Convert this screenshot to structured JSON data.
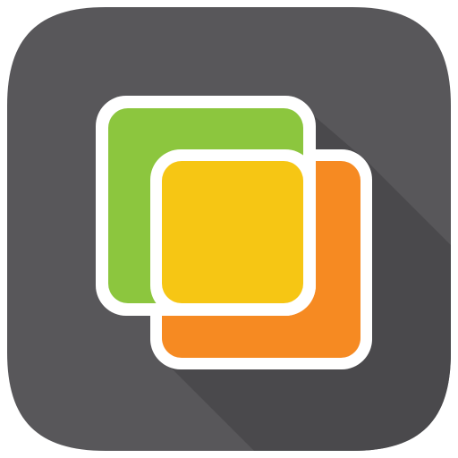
{
  "app_icon": {
    "icon_name": "overlapping-squares-icon",
    "colors": {
      "tile_background": "#58575a",
      "long_shadow": "#4a494c",
      "outline": "#ffffff",
      "back_square": "#8cc63e",
      "front_square": "#f6c614",
      "overlap_lens": "#f7c612",
      "lower_right_square": "#f68a22"
    }
  }
}
